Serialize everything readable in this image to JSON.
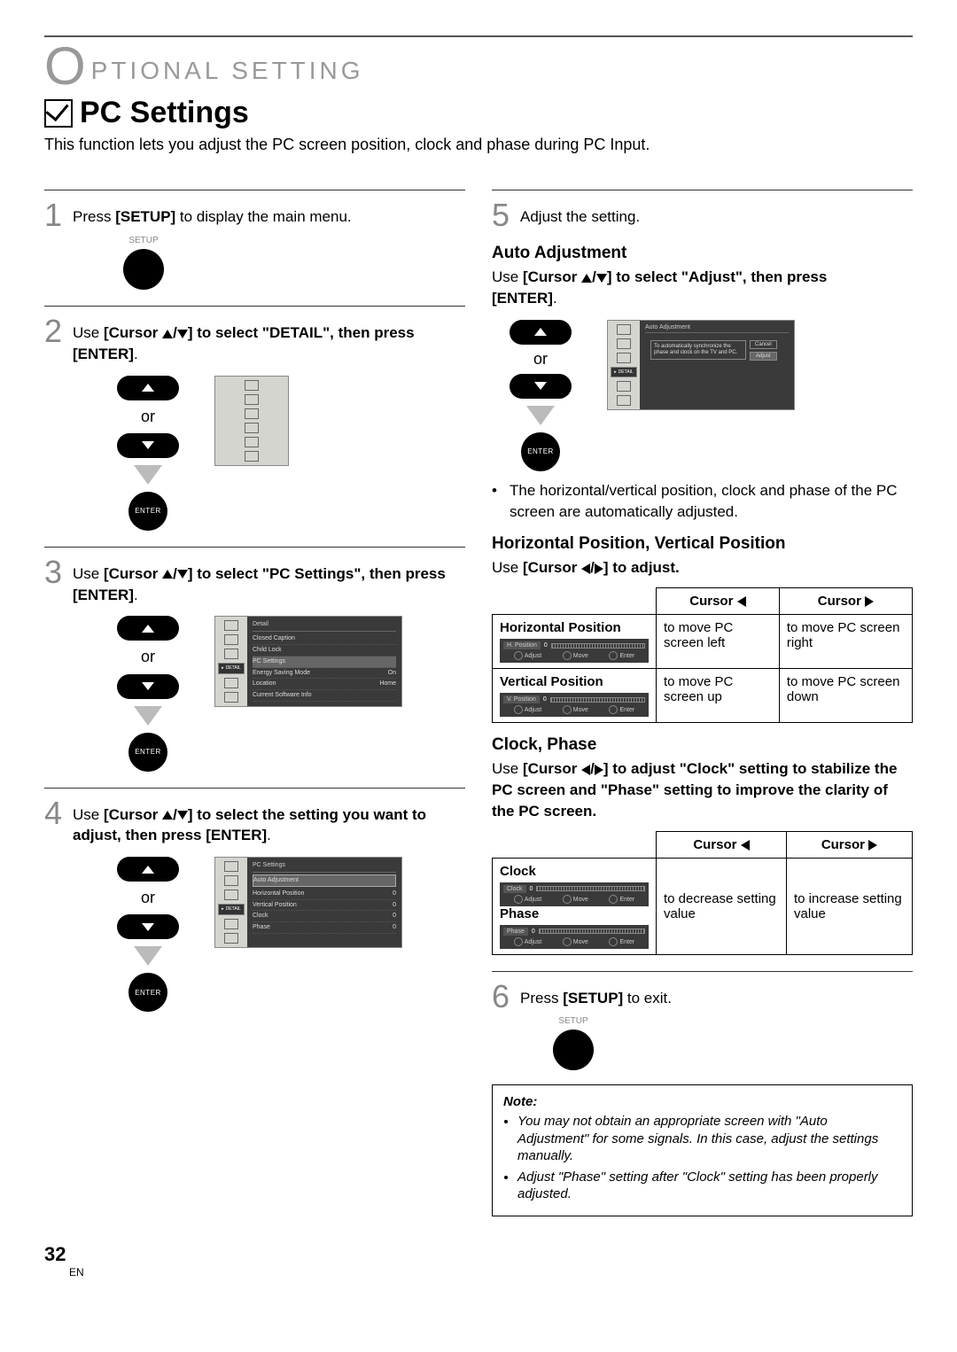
{
  "header": "PTIONAL SETTING",
  "title": "PC Settings",
  "intro": "This function lets you adjust the PC screen position, clock and phase during PC Input.",
  "or": "or",
  "enter_btn": "ENTER",
  "setup_btn": "SETUP",
  "steps": {
    "s1": {
      "num": "1",
      "pre": "Press ",
      "btn": "[SETUP]",
      "post": " to display the main menu."
    },
    "s2": {
      "num": "2",
      "pre": "Use ",
      "btn": "[Cursor ",
      "target": "] to select \"DETAIL\", then press",
      "enter": "[ENTER]",
      "period": "."
    },
    "s3": {
      "num": "3",
      "pre": "Use ",
      "btn": "[Cursor ",
      "target": "] to select \"PC Settings\", then press",
      "enter": "[ENTER]",
      "period": "."
    },
    "s4": {
      "num": "4",
      "pre": "Use ",
      "btn": "[Cursor ",
      "target": "] to select the setting you want to adjust, then press ",
      "enter": "[ENTER]",
      "period": "."
    },
    "s5": {
      "num": "5",
      "text": "Adjust the setting."
    },
    "s6": {
      "num": "6",
      "pre": "Press ",
      "btn": "[SETUP]",
      "post": " to exit."
    }
  },
  "osd": {
    "detail_tag": "DETAIL",
    "menu3": {
      "title": "Detail",
      "rows": [
        {
          "l": "Closed Caption",
          "r": ""
        },
        {
          "l": "Child Lock",
          "r": ""
        },
        {
          "l": "PC Settings",
          "r": "",
          "hi": true
        },
        {
          "l": "Energy Saving Mode",
          "r": "On"
        },
        {
          "l": "Location",
          "r": "Home"
        },
        {
          "l": "Current Software Info",
          "r": ""
        }
      ]
    },
    "menu4": {
      "title": "PC Settings",
      "rows": [
        {
          "l": "Auto Adjustment",
          "r": "",
          "hi": true
        },
        {
          "l": "Horizontal Position",
          "r": "0"
        },
        {
          "l": "Vertical Position",
          "r": "0"
        },
        {
          "l": "Clock",
          "r": "0"
        },
        {
          "l": "Phase",
          "r": "0"
        }
      ]
    },
    "auto": {
      "title": "Auto Adjustment",
      "msg": "To automatically synchronize the phase and clock on the TV and PC.",
      "cancel": "Cancel",
      "adjust": "Adjust"
    }
  },
  "right": {
    "auto_head": "Auto Adjustment",
    "auto_body_pre": "Use ",
    "auto_body_btn": "[Cursor ",
    "auto_body_post": "] to select \"Adjust\", then press",
    "auto_enter": "[ENTER]",
    "auto_period": ".",
    "auto_bullet": "The horizontal/vertical position, clock and phase of the PC screen are automatically adjusted.",
    "hv_head": "Horizontal Position, Vertical Position",
    "hv_body_pre": "Use ",
    "hv_body_btn": "[Cursor ",
    "hv_body_post": "] to adjust.",
    "cp_head": "Clock, Phase",
    "cp_body_pre": "Use ",
    "cp_body_btn": "[Cursor ",
    "cp_body_post": "] to adjust \"Clock\" setting to stabilize the PC screen and \"Phase\" setting to improve the clarity of the PC screen."
  },
  "table_hv": {
    "head_l": "Cursor",
    "head_r": "Cursor",
    "rows": [
      {
        "name": "Horizontal Position",
        "osd_label": "H. Position",
        "val": "0",
        "left": "to move PC screen left",
        "right": "to move PC screen right"
      },
      {
        "name": "Vertical Position",
        "osd_label": "V. Position",
        "val": "0",
        "left": "to move PC screen up",
        "right": "to move PC screen down"
      }
    ]
  },
  "table_cp": {
    "head_l": "Cursor",
    "head_r": "Cursor",
    "rows": [
      {
        "name": "Clock",
        "osd_label": "Clock",
        "val": "0"
      },
      {
        "name": "Phase",
        "osd_label": "Phase",
        "val": "0"
      }
    ],
    "merged_left": "to decrease setting value",
    "merged_right": "to increase setting value"
  },
  "mini_osd_btns": {
    "adjust": "Adjust",
    "move": "Move",
    "enter": "Enter"
  },
  "note": {
    "title": "Note:",
    "items": [
      "You may not obtain an appropriate screen with \"Auto Adjustment\" for some signals. In this case, adjust the settings manually.",
      "Adjust \"Phase\" setting after \"Clock\" setting has been properly adjusted."
    ]
  },
  "page_number": "32",
  "lang": "EN"
}
